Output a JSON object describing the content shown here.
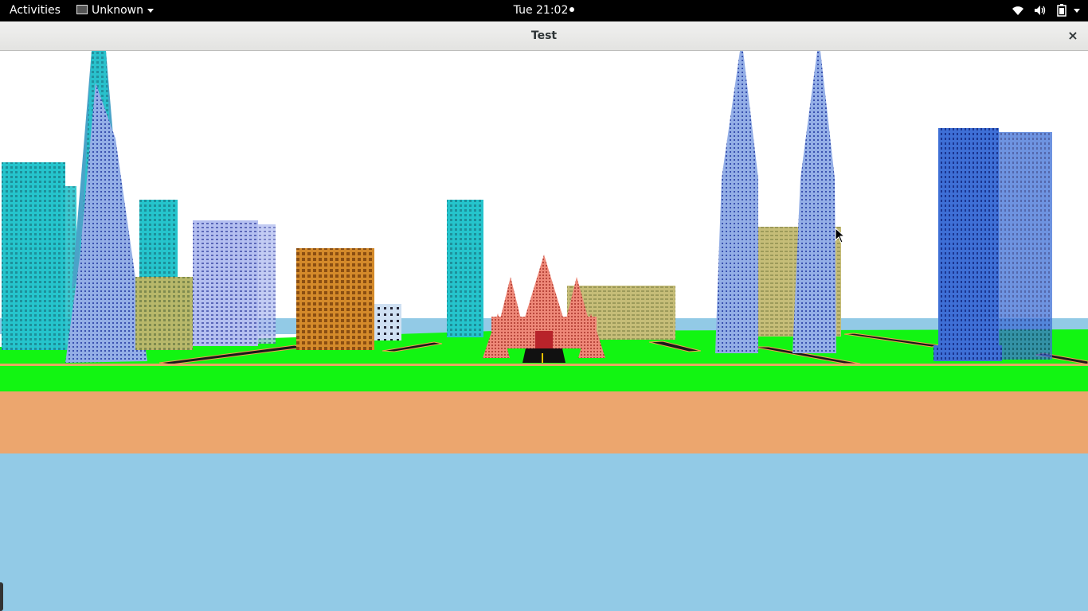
{
  "topbar": {
    "activities": "Activities",
    "app_menu": "Unknown",
    "clock": "Tue 21:02"
  },
  "window": {
    "title": "Test",
    "close_glyph": "×"
  },
  "icons": {
    "tray": [
      "wifi-icon",
      "volume-icon",
      "battery-icon",
      "system-menu-caret"
    ],
    "cursor": "mouse-pointer-icon"
  },
  "colors": {
    "sky": "#ffffff",
    "grass": "#12f512",
    "sand": "#eca66e",
    "water": "#92cae6",
    "temple": "#e8806e"
  }
}
